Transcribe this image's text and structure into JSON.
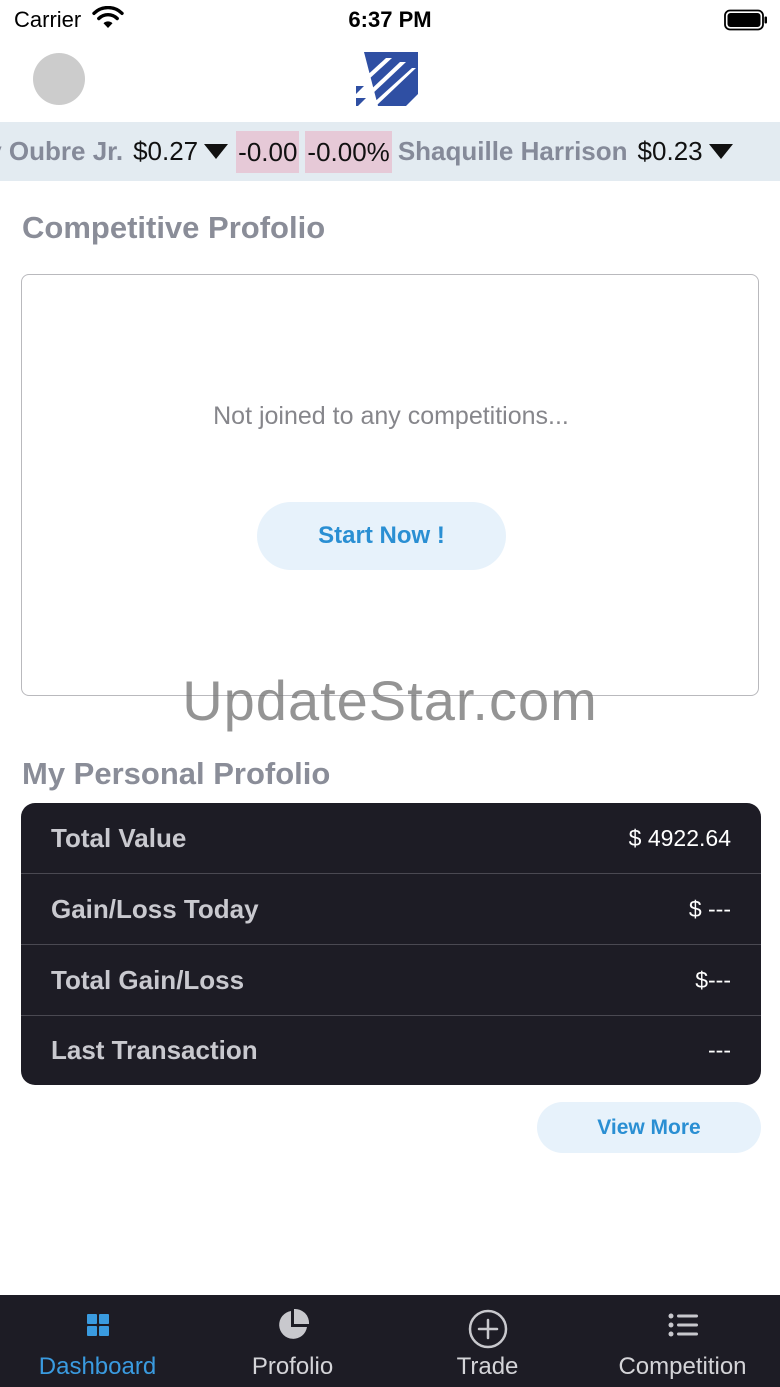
{
  "status_bar": {
    "carrier": "Carrier",
    "time": "6:37 PM"
  },
  "ticker": {
    "items": [
      {
        "name": "ly Oubre Jr.",
        "price": "$0.27",
        "change": "-0.00",
        "change_pct": "-0.00%"
      },
      {
        "name": "Shaquille Harrison",
        "price": "$0.23"
      }
    ]
  },
  "competitive": {
    "title": "Competitive Profolio",
    "empty_text": "Not joined to any competitions...",
    "start_label": "Start Now !"
  },
  "watermark": "UpdateStar.com",
  "personal": {
    "title": "My Personal Profolio",
    "rows": [
      {
        "label": "Total Value",
        "value": "$ 4922.64"
      },
      {
        "label": "Gain/Loss Today",
        "value": "$ ---"
      },
      {
        "label": "Total Gain/Loss",
        "value": "$---"
      },
      {
        "label": "Last Transaction",
        "value": "---"
      }
    ],
    "view_more_label": "View More"
  },
  "nav": {
    "items": [
      {
        "label": "Dashboard",
        "icon": "grid-icon",
        "active": true
      },
      {
        "label": "Profolio",
        "icon": "pie-chart-icon"
      },
      {
        "label": "Trade",
        "icon": "plus-circle-icon"
      },
      {
        "label": "Competition",
        "icon": "list-icon"
      }
    ]
  },
  "colors": {
    "accent": "#3a9be0",
    "dark_panel": "#1d1c25",
    "ticker_bg": "#e3ebf1",
    "change_bg": "#e6c9d7"
  }
}
